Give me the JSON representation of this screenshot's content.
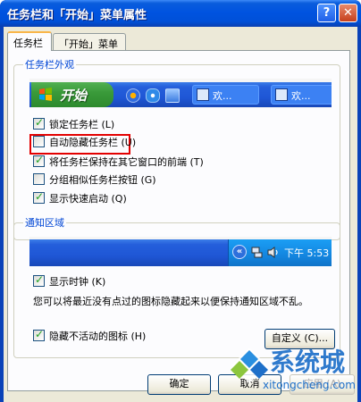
{
  "window": {
    "title": "任务栏和「开始」菜单属性",
    "help_icon": "question-icon",
    "close_icon": "close-icon",
    "help_glyph": "?",
    "close_glyph": "✕"
  },
  "tabs": [
    {
      "label": "任务栏",
      "active": true
    },
    {
      "label": "「开始」菜单",
      "active": false
    }
  ],
  "taskbar_group": {
    "legend": "任务栏外观",
    "preview": {
      "start_label": "开始",
      "task_buttons": [
        "欢...",
        "欢..."
      ]
    },
    "options": [
      {
        "label": "锁定任务栏 (L)",
        "checked": true,
        "highlighted": true
      },
      {
        "label": "自动隐藏任务栏 (U)",
        "checked": false
      },
      {
        "label": "将任务栏保持在其它窗口的前端 (T)",
        "checked": true
      },
      {
        "label": "分组相似任务栏按钮 (G)",
        "checked": false
      },
      {
        "label": "显示快速启动 (Q)",
        "checked": true
      }
    ]
  },
  "notify_group": {
    "legend": "通知区域",
    "preview": {
      "chevron": "«",
      "clock": "下午 5:53"
    },
    "show_clock": {
      "label": "显示时钟 (K)",
      "checked": true
    },
    "description": "您可以将最近没有点过的图标隐藏起来以便保持通知区域不乱。",
    "hide_inactive": {
      "label": "隐藏不活动的图标 (H)",
      "checked": true
    },
    "customize_label": "自定义 (C)..."
  },
  "buttons": {
    "ok": "确定",
    "cancel": "取消",
    "apply": "应用 (A)"
  },
  "watermark": {
    "text": "系统城",
    "url": "xitongcheng.com"
  },
  "colors": {
    "titlebar": "#0053e0",
    "highlight_box": "#e30000",
    "legend_text": "#0046d5",
    "watermark": "#1e6fc9"
  }
}
